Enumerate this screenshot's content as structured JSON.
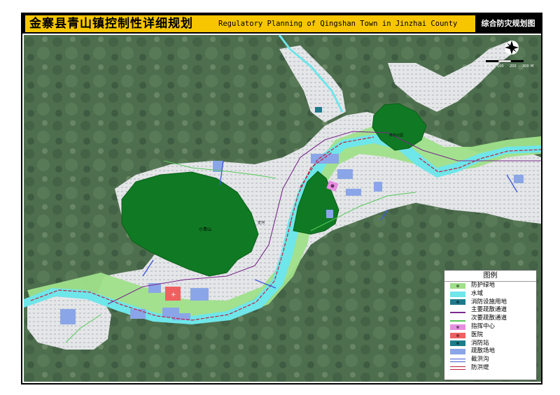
{
  "title": {
    "cn": "金寨县青山镇控制性详细规划",
    "en": "Regulatory Planning of Qingshan Town in Jinzhai County",
    "map_name": "综合防灾规划图"
  },
  "map_labels": {
    "hill_center": "小青山",
    "hill_ne": "养石公园",
    "river_label": "史河"
  },
  "scale": {
    "ticks": [
      "0",
      "100",
      "200",
      "300"
    ],
    "unit": "M"
  },
  "legend": {
    "title": "图例",
    "items": [
      {
        "label": "防护绿地",
        "color": "#9fe08a",
        "kind": "fill-dot"
      },
      {
        "label": "水域",
        "color": "#6ee6ea",
        "kind": "fill"
      },
      {
        "label": "消防设施用地",
        "color": "#1f7a8c",
        "kind": "fill-dot"
      },
      {
        "label": "主要疏散通道",
        "color": "#7b2a8c",
        "kind": "line"
      },
      {
        "label": "次要疏散通道",
        "color": "#56c85a",
        "kind": "line"
      },
      {
        "label": "指挥中心",
        "color": "#e78ee0",
        "kind": "fill-dot"
      },
      {
        "label": "医院",
        "color": "#f06060",
        "kind": "fill-dot"
      },
      {
        "label": "消防站",
        "color": "#1a7d8a",
        "kind": "fill-dot"
      },
      {
        "label": "疏散场地",
        "color": "#8aa6e8",
        "kind": "fill"
      },
      {
        "label": "截洪沟",
        "color": "#3f5ad8",
        "kind": "double-line"
      },
      {
        "label": "防洪堤",
        "color": "#c0213a",
        "kind": "double-line"
      }
    ]
  }
}
